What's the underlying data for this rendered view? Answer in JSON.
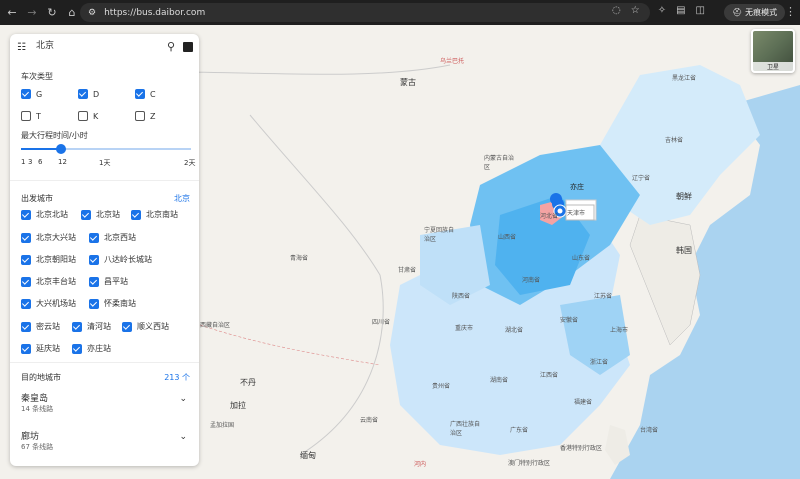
{
  "browser": {
    "url": "https://bus.daibor.com",
    "incognito_label": "无痕模式"
  },
  "search": {
    "value": "北京"
  },
  "train_types": {
    "title": "车次类型",
    "items": [
      {
        "label": "G",
        "checked": true
      },
      {
        "label": "D",
        "checked": true
      },
      {
        "label": "C",
        "checked": true
      },
      {
        "label": "T",
        "checked": false
      },
      {
        "label": "K",
        "checked": false
      },
      {
        "label": "Z",
        "checked": false
      }
    ]
  },
  "max_time": {
    "title": "最大行程时间/小时",
    "ticks": [
      "1",
      "3",
      "6",
      "12",
      "1天",
      "2天"
    ],
    "value_hours": 12
  },
  "departure": {
    "title": "出发城市",
    "city": "北京",
    "stations": [
      "北京北站",
      "北京站",
      "北京南站",
      "北京大兴站",
      "北京西站",
      "北京朝阳站",
      "八达岭长城站",
      "北京丰台站",
      "昌平站",
      "大兴机场站",
      "怀柔南站",
      "密云站",
      "清河站",
      "顺义西站",
      "延庆站",
      "亦庄站"
    ]
  },
  "destination": {
    "title": "目的地城市",
    "count": "213 个",
    "cities": [
      {
        "name": "秦皇岛",
        "routes": "14 条线路"
      },
      {
        "name": "廊坊",
        "routes": "67 条线路"
      }
    ]
  },
  "map": {
    "satellite_label": "卫星",
    "popup_label": "亦庄",
    "accent": "#1a73e8",
    "labels": [
      "蒙古",
      "乌兰巴托",
      "黑龙江省",
      "吉林省",
      "辽宁省",
      "朝鲜",
      "韩国",
      "内蒙古自治区",
      "河北省",
      "天津市",
      "山西省",
      "山东省",
      "宁夏回族自治区",
      "甘肃省",
      "陕西省",
      "河南省",
      "江苏省",
      "上海市",
      "安徽省",
      "湖北省",
      "四川省",
      "重庆市",
      "浙江省",
      "湖南省",
      "江西省",
      "贵州省",
      "福建省",
      "广西壮族自治区",
      "广东省",
      "台湾省",
      "西藏自治区",
      "青海省",
      "云南省",
      "不丹",
      "孟加拉国",
      "缅甸",
      "香港特别行政区",
      "澳门特别行政区",
      "河内",
      "加拉"
    ]
  }
}
